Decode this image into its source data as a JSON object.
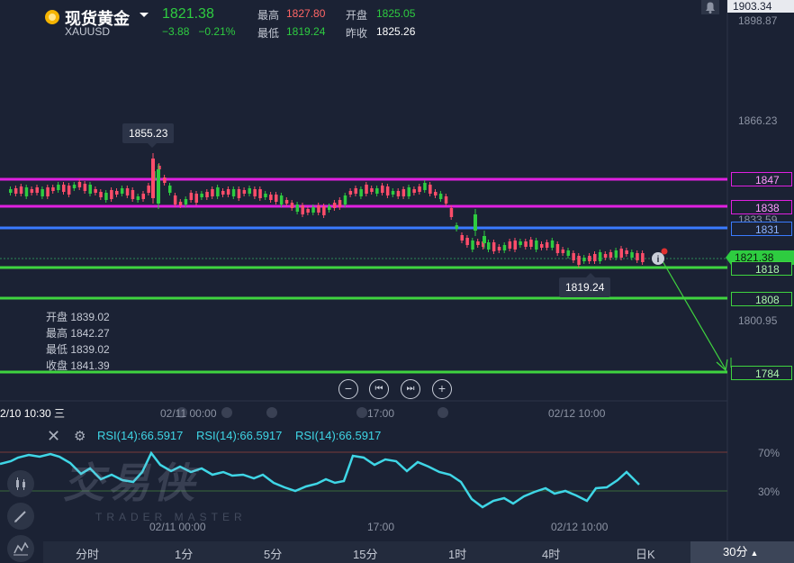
{
  "header": {
    "title": "现货黄金",
    "symbol": "XAUUSD",
    "price": "1821.38",
    "change": "−3.88",
    "change_pct": "−0.21%",
    "high_label": "最高",
    "high_value": "1827.80",
    "low_label": "最低",
    "low_value": "1819.24",
    "open_label": "开盘",
    "open_value": "1825.05",
    "prev_label": "昨收",
    "prev_value": "1825.26"
  },
  "ohlc_panel": {
    "open": "开盘 1839.02",
    "high": "最高 1842.27",
    "low": "最低 1839.02",
    "close": "收盘 1841.39"
  },
  "y_axis": {
    "top_value": "1903.34",
    "labels": [
      "1898.87",
      "1866.23",
      "1833.59",
      "1800.95"
    ]
  },
  "levels": [
    {
      "value": "1847",
      "color": "#e020e0"
    },
    {
      "value": "1838",
      "color": "#e020e0"
    },
    {
      "value": "1831",
      "color": "#3a7bff"
    },
    {
      "value": "1818",
      "color": "#3fd43f"
    },
    {
      "value": "1808",
      "color": "#3fd43f"
    },
    {
      "value": "1784",
      "color": "#3fd43f"
    }
  ],
  "current_price_tag": "1821.38",
  "tooltips": {
    "high_marker": "1855.23",
    "low_marker": "1819.24"
  },
  "nav_buttons": {
    "zoom_out": "−",
    "prev": "⏮",
    "next": "⏭",
    "zoom_in": "+"
  },
  "x_axis": {
    "cursor_time": "2/10 10:30 三",
    "main": [
      "02/11 00:00",
      "17:00",
      "02/12 10:00"
    ],
    "rsi": [
      "02/11 00:00",
      "17:00",
      "02/12 10:00"
    ]
  },
  "rsi": {
    "labels": [
      "RSI(14):66.5917",
      "RSI(14):66.5917",
      "RSI(14):66.5917"
    ],
    "upper": "70%",
    "lower": "30%"
  },
  "watermark": {
    "main": "交易侠",
    "sub": "TRADER MASTER"
  },
  "timeframes": [
    "分时",
    "1分",
    "5分",
    "15分",
    "1时",
    "4时",
    "日K"
  ],
  "active_timeframe": "30分",
  "colors": {
    "up": "#ff4d6a",
    "down": "#2ecc40",
    "rsi": "#3fd6e6"
  }
}
